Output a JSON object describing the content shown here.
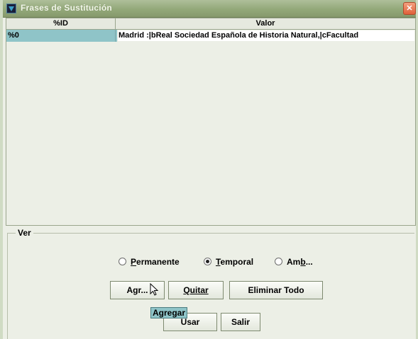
{
  "window": {
    "title": "Frases de Sustitución"
  },
  "table": {
    "columns": [
      "%ID",
      "Valor"
    ],
    "rows": [
      {
        "id": "%0",
        "valor": "Madrid :|bReal Sociedad Española de Historia Natural,|cFacultad"
      }
    ]
  },
  "ver": {
    "legend": "Ver",
    "options": [
      {
        "label": "Permanente",
        "selected": false
      },
      {
        "label": "Temporal",
        "selected": true
      },
      {
        "label": "Amb...",
        "selected": false
      }
    ]
  },
  "buttons": {
    "agregar": "Agr...",
    "quitar": "Quitar",
    "eliminar_todo": "Eliminar Todo",
    "usar": "Usar",
    "salir": "Salir"
  },
  "tooltip": "Agregar",
  "colors": {
    "title_bar": "#93a879",
    "selection": "#8fc4c8",
    "background": "#ecefe6"
  }
}
